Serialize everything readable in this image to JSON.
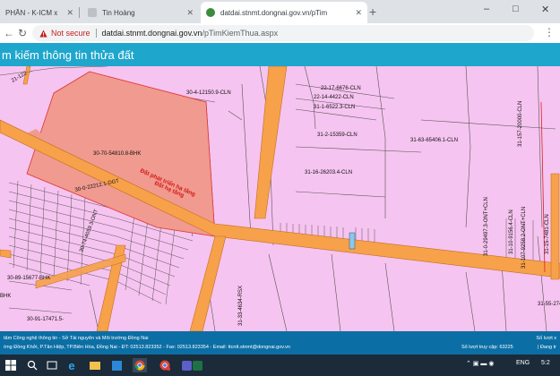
{
  "browser": {
    "tabs": [
      {
        "label": "PHẦN - K-ICM x"
      },
      {
        "label": "Tin Hoàng"
      },
      {
        "label": "datdai.stnmt.dongnai.gov.vn/pTim"
      }
    ],
    "new_tab": "+",
    "window_controls": [
      "–",
      "□",
      "✕"
    ],
    "security_label": "Not secure",
    "url_host": "datdai.stnmt.dongnai.gov.vn",
    "url_path": "/pTimKiemThua.aspx"
  },
  "page": {
    "title": "m kiếm thông tin thửa đất"
  },
  "map": {
    "parcels": [
      "21-122-...",
      "30-4-12150.9-CLN",
      "22-17-6676-CLN",
      "22-14-4422-CLN",
      "31-1-6522.3-CLN",
      "31-2-15359-CLN",
      "31-63-65406.1-CLN",
      "31-16-26203.4-CLN",
      "30-70-54810.8-BHK",
      "30-0-22212.1-DGT",
      "30-74-4059.3-ONT",
      "30-89-15677-BHK",
      "30-91-17471.5-",
      "31-33-4634-RSX",
      "31-0-29497.3-ONT+CLN",
      "31-10-9156.4-CLN",
      "31-107-9258.2-ONT+CLN",
      "31-15-7481-CLN",
      "31-157-20000-CLN",
      "31-55-274",
      "BHK"
    ],
    "annotation_line1": "Đất phát triển hạ tầng",
    "annotation_line2": "Đất hạ tầng",
    "colors": {
      "residential_plot": "#f6c4f0",
      "road": "#f7a14a",
      "selected_parcel": "#f19a8f"
    }
  },
  "footer": {
    "line1": "tâm Công nghệ thông tin - Sở Tài nguyên và Môi trường Đồng Nai",
    "line2": "ờng Đồng Khởi, P.Tân Hiệp, TP.Biên Hòa, Đồng Nai - ĐT: 02513.823352 - Fax: 02513.823354 - Email: ttcntt.stnmt@dongnai.gov.vn",
    "right_top": "Số lượt x",
    "visit_count": "Số lượt truy cập: 63225",
    "right_bottom": "| Đang tr"
  },
  "taskbar": {
    "icons": [
      "windows-start-icon",
      "search-icon",
      "task-view-icon",
      "edge-icon",
      "file-explorer-icon",
      "store-icon",
      "chrome-icon",
      "chrome-profile-icon",
      "teams-icon",
      "excel-icon"
    ],
    "lang": "ENG",
    "time": "5:2"
  }
}
